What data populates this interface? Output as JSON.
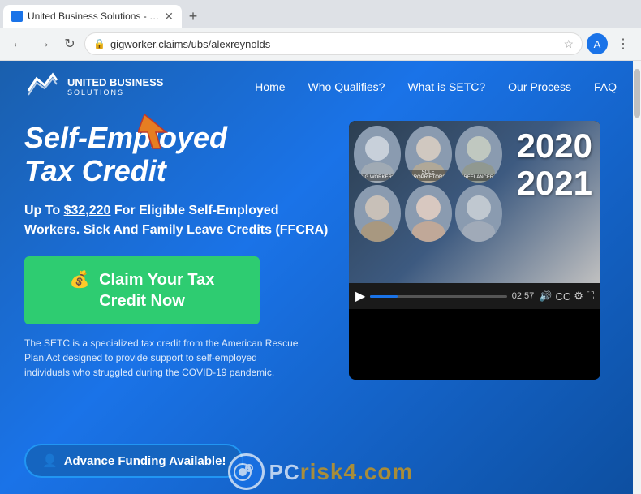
{
  "browser": {
    "tab_title": "United Business Solutions - Self...",
    "url": "gigworker.claims/ubs/alexreynolds",
    "back_btn": "←",
    "forward_btn": "→",
    "reload_btn": "↻"
  },
  "nav": {
    "logo_line1": "UNITED BUSINESS",
    "logo_line2": "SOLUTIONS",
    "links": [
      "Home",
      "Who Qualifies?",
      "What is SETC?",
      "Our Process",
      "FAQ"
    ]
  },
  "hero": {
    "title_line1": "Self-Employed",
    "title_line2": "Tax Credit",
    "subtitle": "Up To $32,220 For Eligible Self-Employed Workers. Sick And Family Leave Credits (FFCRA)",
    "cta_label": "Claim Your Tax Credit Now",
    "description": "The SETC is a specialized tax credit from the American Rescue Plan Act designed to provide support to self-employed individuals who struggled during the COVID-19 pandemic.",
    "advance_btn_label": "Advance Funding Available!"
  },
  "video": {
    "year_line1": "2020",
    "year_line2": "2021",
    "time": "02:57",
    "people": [
      {
        "label": "GIG WORKERS"
      },
      {
        "label": "SOLE PROPRIETORS"
      },
      {
        "label": "FREELANCERS"
      },
      {
        "label": ""
      },
      {
        "label": ""
      },
      {
        "label": ""
      }
    ]
  },
  "watermark": {
    "text": "risk4.com",
    "prefix": "PC"
  }
}
